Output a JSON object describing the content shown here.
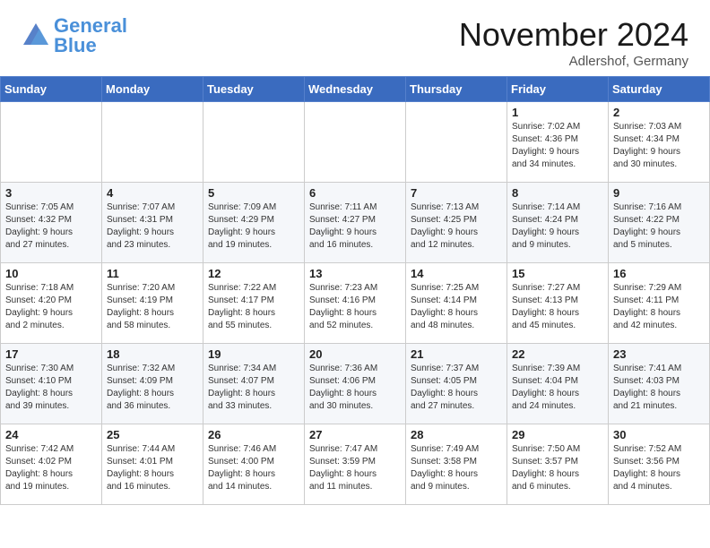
{
  "header": {
    "logo_general": "General",
    "logo_blue": "Blue",
    "month": "November 2024",
    "location": "Adlershof, Germany"
  },
  "weekdays": [
    "Sunday",
    "Monday",
    "Tuesday",
    "Wednesday",
    "Thursday",
    "Friday",
    "Saturday"
  ],
  "weeks": [
    [
      {
        "day": "",
        "info": ""
      },
      {
        "day": "",
        "info": ""
      },
      {
        "day": "",
        "info": ""
      },
      {
        "day": "",
        "info": ""
      },
      {
        "day": "",
        "info": ""
      },
      {
        "day": "1",
        "info": "Sunrise: 7:02 AM\nSunset: 4:36 PM\nDaylight: 9 hours\nand 34 minutes."
      },
      {
        "day": "2",
        "info": "Sunrise: 7:03 AM\nSunset: 4:34 PM\nDaylight: 9 hours\nand 30 minutes."
      }
    ],
    [
      {
        "day": "3",
        "info": "Sunrise: 7:05 AM\nSunset: 4:32 PM\nDaylight: 9 hours\nand 27 minutes."
      },
      {
        "day": "4",
        "info": "Sunrise: 7:07 AM\nSunset: 4:31 PM\nDaylight: 9 hours\nand 23 minutes."
      },
      {
        "day": "5",
        "info": "Sunrise: 7:09 AM\nSunset: 4:29 PM\nDaylight: 9 hours\nand 19 minutes."
      },
      {
        "day": "6",
        "info": "Sunrise: 7:11 AM\nSunset: 4:27 PM\nDaylight: 9 hours\nand 16 minutes."
      },
      {
        "day": "7",
        "info": "Sunrise: 7:13 AM\nSunset: 4:25 PM\nDaylight: 9 hours\nand 12 minutes."
      },
      {
        "day": "8",
        "info": "Sunrise: 7:14 AM\nSunset: 4:24 PM\nDaylight: 9 hours\nand 9 minutes."
      },
      {
        "day": "9",
        "info": "Sunrise: 7:16 AM\nSunset: 4:22 PM\nDaylight: 9 hours\nand 5 minutes."
      }
    ],
    [
      {
        "day": "10",
        "info": "Sunrise: 7:18 AM\nSunset: 4:20 PM\nDaylight: 9 hours\nand 2 minutes."
      },
      {
        "day": "11",
        "info": "Sunrise: 7:20 AM\nSunset: 4:19 PM\nDaylight: 8 hours\nand 58 minutes."
      },
      {
        "day": "12",
        "info": "Sunrise: 7:22 AM\nSunset: 4:17 PM\nDaylight: 8 hours\nand 55 minutes."
      },
      {
        "day": "13",
        "info": "Sunrise: 7:23 AM\nSunset: 4:16 PM\nDaylight: 8 hours\nand 52 minutes."
      },
      {
        "day": "14",
        "info": "Sunrise: 7:25 AM\nSunset: 4:14 PM\nDaylight: 8 hours\nand 48 minutes."
      },
      {
        "day": "15",
        "info": "Sunrise: 7:27 AM\nSunset: 4:13 PM\nDaylight: 8 hours\nand 45 minutes."
      },
      {
        "day": "16",
        "info": "Sunrise: 7:29 AM\nSunset: 4:11 PM\nDaylight: 8 hours\nand 42 minutes."
      }
    ],
    [
      {
        "day": "17",
        "info": "Sunrise: 7:30 AM\nSunset: 4:10 PM\nDaylight: 8 hours\nand 39 minutes."
      },
      {
        "day": "18",
        "info": "Sunrise: 7:32 AM\nSunset: 4:09 PM\nDaylight: 8 hours\nand 36 minutes."
      },
      {
        "day": "19",
        "info": "Sunrise: 7:34 AM\nSunset: 4:07 PM\nDaylight: 8 hours\nand 33 minutes."
      },
      {
        "day": "20",
        "info": "Sunrise: 7:36 AM\nSunset: 4:06 PM\nDaylight: 8 hours\nand 30 minutes."
      },
      {
        "day": "21",
        "info": "Sunrise: 7:37 AM\nSunset: 4:05 PM\nDaylight: 8 hours\nand 27 minutes."
      },
      {
        "day": "22",
        "info": "Sunrise: 7:39 AM\nSunset: 4:04 PM\nDaylight: 8 hours\nand 24 minutes."
      },
      {
        "day": "23",
        "info": "Sunrise: 7:41 AM\nSunset: 4:03 PM\nDaylight: 8 hours\nand 21 minutes."
      }
    ],
    [
      {
        "day": "24",
        "info": "Sunrise: 7:42 AM\nSunset: 4:02 PM\nDaylight: 8 hours\nand 19 minutes."
      },
      {
        "day": "25",
        "info": "Sunrise: 7:44 AM\nSunset: 4:01 PM\nDaylight: 8 hours\nand 16 minutes."
      },
      {
        "day": "26",
        "info": "Sunrise: 7:46 AM\nSunset: 4:00 PM\nDaylight: 8 hours\nand 14 minutes."
      },
      {
        "day": "27",
        "info": "Sunrise: 7:47 AM\nSunset: 3:59 PM\nDaylight: 8 hours\nand 11 minutes."
      },
      {
        "day": "28",
        "info": "Sunrise: 7:49 AM\nSunset: 3:58 PM\nDaylight: 8 hours\nand 9 minutes."
      },
      {
        "day": "29",
        "info": "Sunrise: 7:50 AM\nSunset: 3:57 PM\nDaylight: 8 hours\nand 6 minutes."
      },
      {
        "day": "30",
        "info": "Sunrise: 7:52 AM\nSunset: 3:56 PM\nDaylight: 8 hours\nand 4 minutes."
      }
    ]
  ]
}
